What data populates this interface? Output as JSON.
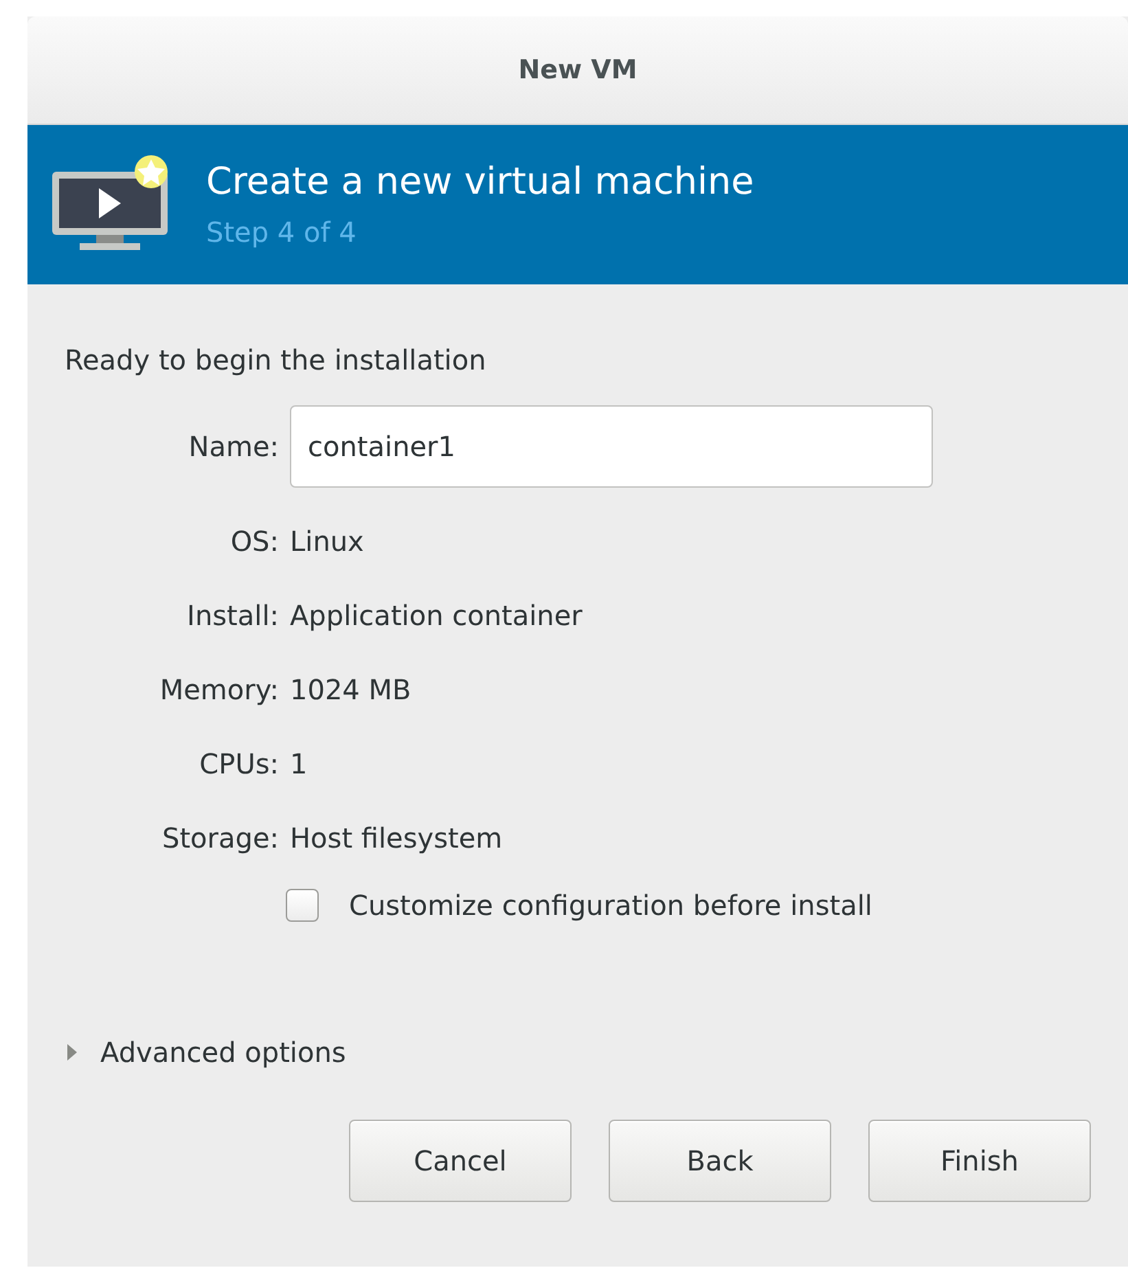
{
  "window": {
    "title": "New VM"
  },
  "header": {
    "title": "Create a new virtual machine",
    "subtitle": "Step 4 of 4"
  },
  "summary": {
    "heading": "Ready to begin the installation",
    "fields": [
      {
        "label": "Name:",
        "kind": "input",
        "value": "container1"
      },
      {
        "label": "OS:",
        "kind": "text",
        "value": "Linux"
      },
      {
        "label": "Install:",
        "kind": "text",
        "value": "Application container"
      },
      {
        "label": "Memory:",
        "kind": "text",
        "value": "1024 MB"
      },
      {
        "label": "CPUs:",
        "kind": "text",
        "value": "1"
      },
      {
        "label": "Storage:",
        "kind": "text",
        "value": "Host filesystem"
      }
    ]
  },
  "customize": {
    "label": "Customize configuration before install",
    "checked": false
  },
  "advanced": {
    "label": "Advanced options",
    "expanded": false
  },
  "buttons": [
    "Cancel",
    "Back",
    "Finish"
  ]
}
